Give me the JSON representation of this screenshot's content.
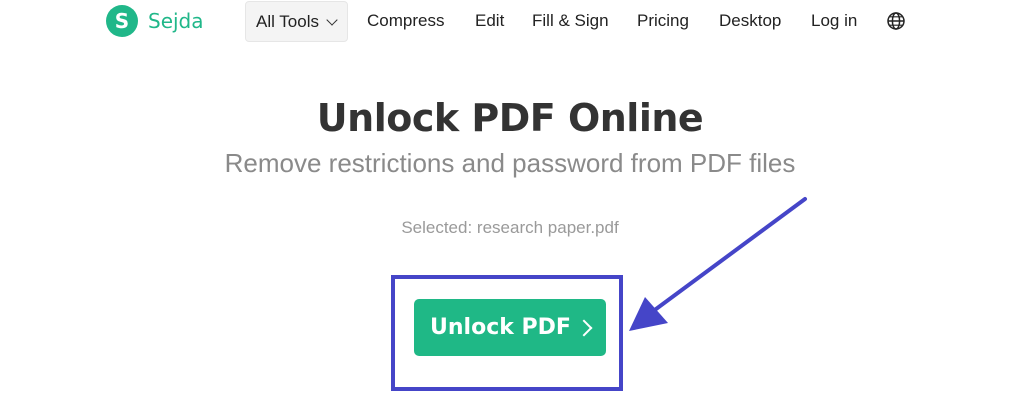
{
  "nav": {
    "logo_letter": "S",
    "logo_text": "Sejda",
    "all_tools": "All Tools",
    "compress": "Compress",
    "edit": "Edit",
    "fill_sign": "Fill & Sign",
    "pricing": "Pricing",
    "desktop": "Desktop",
    "login": "Log in",
    "language_icon": "globe-icon"
  },
  "hero": {
    "title": "Unlock PDF Online",
    "subtitle": "Remove restrictions and password from PDF files",
    "selected": "Selected: research paper.pdf"
  },
  "cta": {
    "label": "Unlock PDF"
  },
  "colors": {
    "brand": "#20b789",
    "button": "#1fb886",
    "annotation": "#4545c8",
    "title": "#333333",
    "subtitle": "#8a8a8a"
  }
}
